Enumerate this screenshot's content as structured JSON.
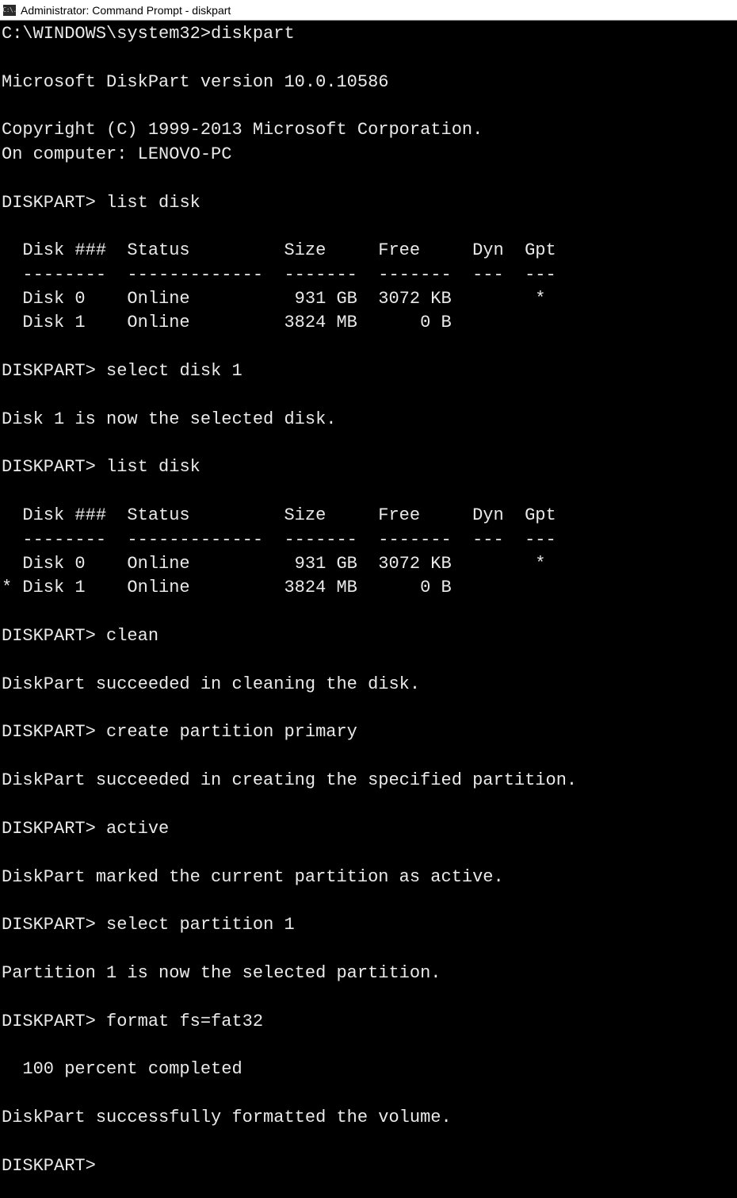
{
  "window": {
    "title": "Administrator: Command Prompt - diskpart",
    "icon_label": "C:\\."
  },
  "terminal": {
    "initial_prompt": "C:\\WINDOWS\\system32>",
    "initial_command": "diskpart",
    "version_line": "Microsoft DiskPart version 10.0.10586",
    "copyright_line": "Copyright (C) 1999-2013 Microsoft Corporation.",
    "computer_line": "On computer: LENOVO-PC",
    "diskpart_prompt": "DISKPART>",
    "commands": {
      "list_disk": "list disk",
      "select_disk_1": "select disk 1",
      "clean": "clean",
      "create_partition_primary": "create partition primary",
      "active": "active",
      "select_partition_1": "select partition 1",
      "format_fat32": "format fs=fat32"
    },
    "disk_table": {
      "header": "  Disk ###  Status         Size     Free     Dyn  Gpt",
      "divider": "  --------  -------------  -------  -------  ---  ---",
      "rows_before": [
        "  Disk 0    Online          931 GB  3072 KB        *",
        "  Disk 1    Online         3824 MB      0 B"
      ],
      "rows_after": [
        "  Disk 0    Online          931 GB  3072 KB        *",
        "* Disk 1    Online         3824 MB      0 B"
      ]
    },
    "messages": {
      "disk1_selected": "Disk 1 is now the selected disk.",
      "clean_ok": "DiskPart succeeded in cleaning the disk.",
      "create_ok": "DiskPart succeeded in creating the specified partition.",
      "active_ok": "DiskPart marked the current partition as active.",
      "partition1_selected": "Partition 1 is now the selected partition.",
      "format_progress": "  100 percent completed",
      "format_ok": "DiskPart successfully formatted the volume."
    }
  }
}
